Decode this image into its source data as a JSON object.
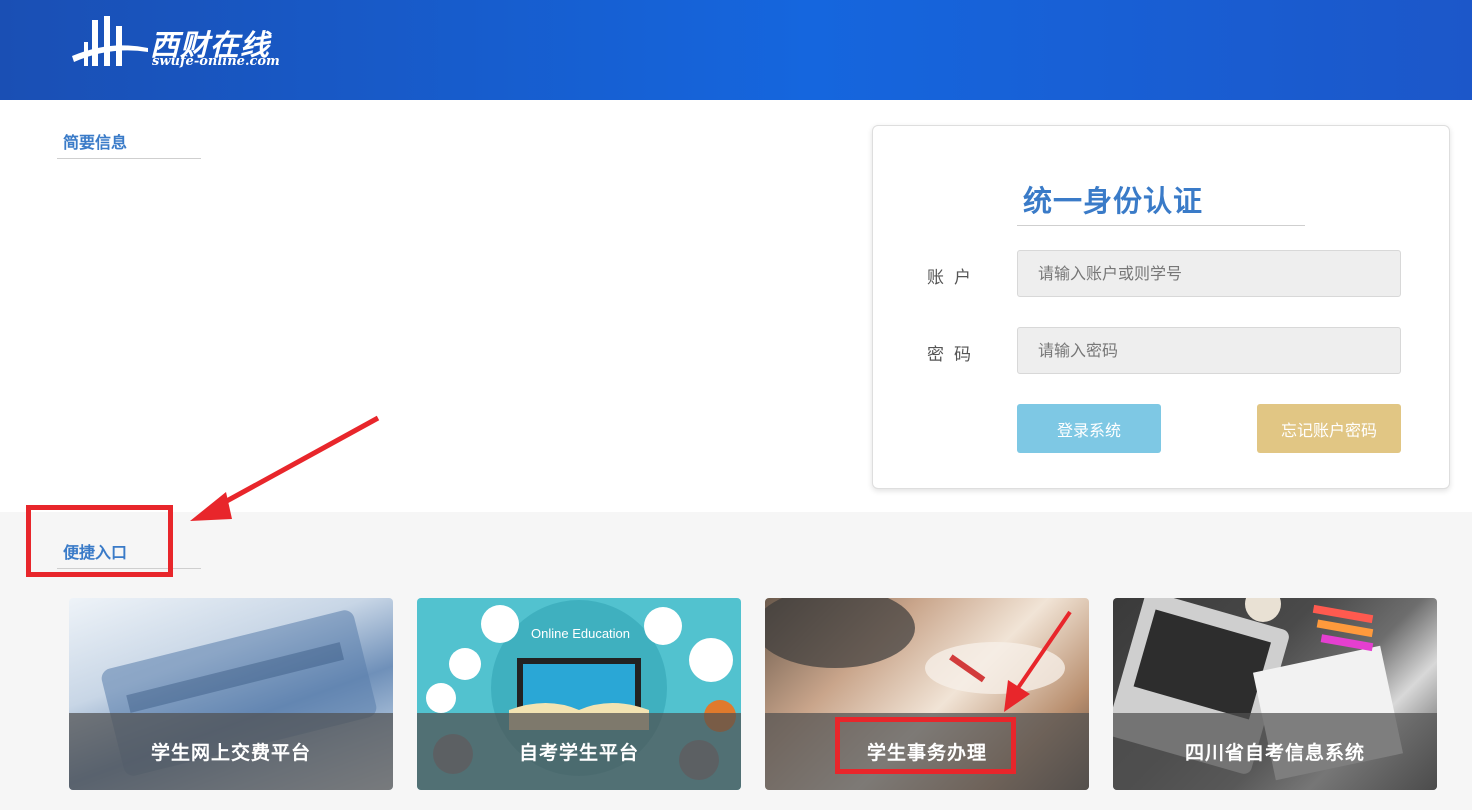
{
  "header": {
    "logo_cn": "西财在线",
    "logo_en": "swufe-online.com",
    "logo_icon": "swufe-logo-icon"
  },
  "info_section": {
    "title": "简要信息"
  },
  "login": {
    "title": "统一身份认证",
    "account_label": "账户",
    "account_placeholder": "请输入账户或则学号",
    "password_label": "密码",
    "password_placeholder": "请输入密码",
    "login_button": "登录系统",
    "forgot_button": "忘记账户密码",
    "login_button_color": "#7ec8e4",
    "forgot_button_color": "#e1c684"
  },
  "quick_section": {
    "title": "便捷入口"
  },
  "tiles": [
    {
      "label": "学生网上交费平台"
    },
    {
      "label": "自考学生平台",
      "image_caption": "Online Education"
    },
    {
      "label": "学生事务办理"
    },
    {
      "label": "四川省自考信息系统"
    }
  ],
  "colors": {
    "accent": "#3a7bc8",
    "header": "#1566de",
    "highlight": "#e8262b"
  }
}
